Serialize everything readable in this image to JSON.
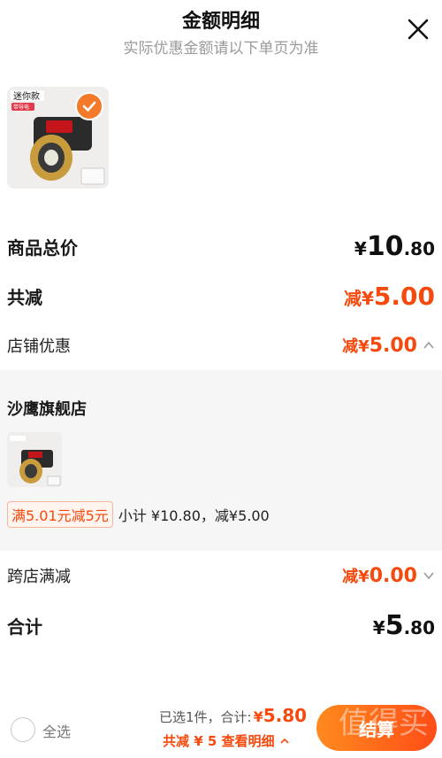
{
  "header": {
    "title": "金额明细",
    "subtitle": "实际优惠金额请以下单页为准"
  },
  "product": {
    "badge": "迷你款",
    "badge_sub": "带导电",
    "selected": true
  },
  "summary": {
    "goods_total_label": "商品总价",
    "goods_total_symbol": "¥",
    "goods_total_int": "10",
    "goods_total_dec": ".80",
    "discount_label": "共减",
    "discount_prefix": "减¥",
    "discount_int": "5",
    "discount_dec": ".00",
    "shop_discount_label": "店铺优惠",
    "shop_discount_prefix": "减¥",
    "shop_discount_int": "5",
    "shop_discount_dec": ".00",
    "cross_shop_label": "跨店满减",
    "cross_shop_prefix": "减¥",
    "cross_shop_int": "0",
    "cross_shop_dec": ".00",
    "total_label": "合计",
    "total_symbol": "¥",
    "total_int": "5",
    "total_dec": ".80"
  },
  "store_panel": {
    "store_name": "沙鹰旗舰店",
    "promo_tag": "满5.01元减5元",
    "promo_text": "小计 ¥10.80，减¥5.00"
  },
  "bottom_bar": {
    "select_all": "全选",
    "selected_text": "已选1件，合计:",
    "total_symbol": "¥",
    "total_value": "5.80",
    "detail_text": "共减 ¥ 5  查看明细",
    "checkout_label": "结算",
    "watermark": "值得买"
  },
  "colors": {
    "accent": "#f5490d",
    "check": "#f47a2b",
    "panel_bg": "#f6f6f6"
  }
}
